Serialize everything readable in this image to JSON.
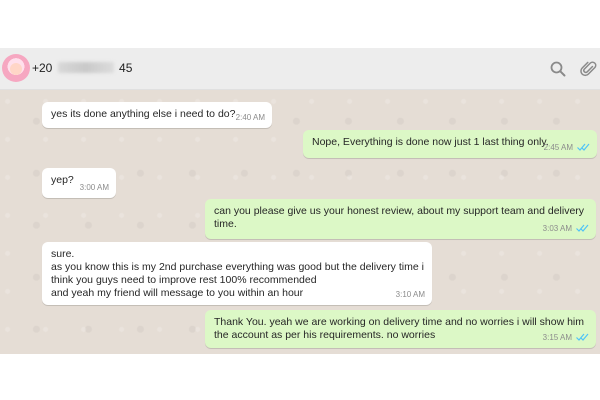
{
  "header": {
    "phone_prefix": "+20",
    "phone_suffix": "45"
  },
  "colors": {
    "header_bg": "#ededed",
    "chat_bg": "#e5ddd5",
    "incoming": "#ffffff",
    "outgoing": "#dcf8c6",
    "read_ticks": "#4fc3f7"
  },
  "icons": [
    "search-icon",
    "attach-icon",
    "double-check-icon"
  ],
  "messages": [
    {
      "dir": "in",
      "text": "yes its done anything else i need to do?",
      "time": "2:40 AM"
    },
    {
      "dir": "out",
      "text": "Nope, Everything is done now just 1 last thing only.",
      "time": "2:45 AM",
      "read": true
    },
    {
      "dir": "in",
      "text": "yep?",
      "time": "3:00 AM"
    },
    {
      "dir": "out",
      "text": "can you please give us your honest review, about my support team and delivery\ntime.",
      "time": "3:03 AM",
      "read": true
    },
    {
      "dir": "in",
      "text": "sure.\nas you know this is my 2nd purchase everything was good but the delivery time i\nthink you guys need to improve rest 100% recommended\nand yeah my friend will message to you within an hour",
      "time": "3:10 AM"
    },
    {
      "dir": "out",
      "text": "Thank You. yeah we are working on delivery time and no worries i will show him\nthe account as per his requirements. no worries",
      "time": "3:15 AM",
      "read": true
    }
  ]
}
